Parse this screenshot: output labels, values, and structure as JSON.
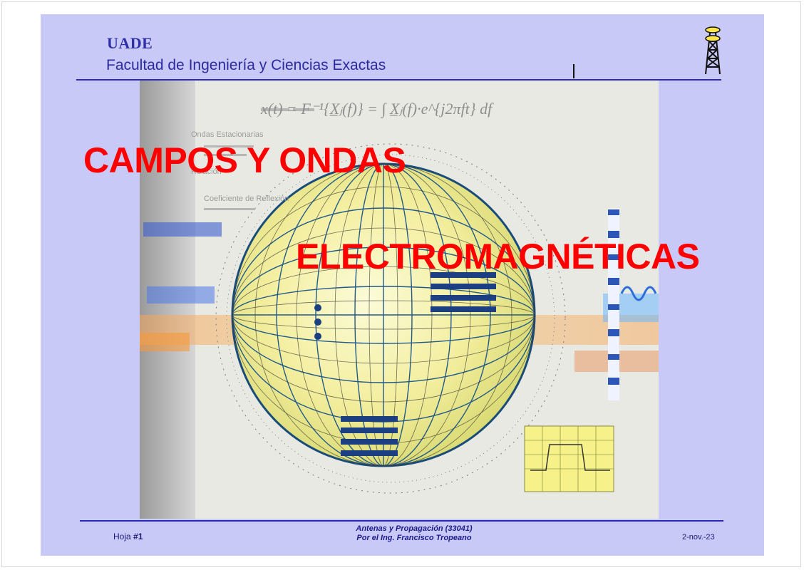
{
  "header": {
    "org": "UADE",
    "faculty": "Facultad de Ingeniería y Ciencias Exactas"
  },
  "title": {
    "line1": "CAMPOS Y ONDAS",
    "line2": "ELECTROMAGNÉTICAS"
  },
  "art": {
    "formula": "x(t) = F⁻¹{X̲ⱼ(f)} = ∫ X̲ⱼ(f)·e^{j2πft} df",
    "caption_lines": [
      "Ondas Estacionarias",
      "Relación",
      "Coeficiente de Reflexión"
    ]
  },
  "footer": {
    "sheet_label": "Hoja ",
    "sheet_number": "#1",
    "course_line1": "Antenas y Propagación (33041)",
    "course_line2": "Por el Ing. Francisco Tropeano",
    "date": "2-nov.-23"
  },
  "colors": {
    "slide_background": "#c9c9f7",
    "title_red": "#ff0000",
    "rule_blue": "#2a2ab5",
    "header_text": "#2b2b9e"
  },
  "icons": [
    "radio-tower-icon"
  ]
}
